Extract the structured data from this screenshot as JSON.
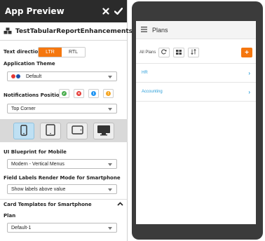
{
  "app_preview": {
    "title": "App Preview",
    "close_icon": "close-icon",
    "confirm_icon": "check-icon"
  },
  "app_name": "TestTabularReportEnhancements",
  "text_direction": {
    "label": "Text direction",
    "options": [
      "LTR",
      "RTL"
    ],
    "selected": "LTR"
  },
  "application_theme": {
    "label": "Application Theme",
    "value": "Default",
    "swatch_colors": [
      "#e53935",
      "#1e4fa8"
    ]
  },
  "notifications_position": {
    "label": "Notifications Position",
    "icons": [
      "success-icon",
      "error-icon",
      "info-icon",
      "warning-icon"
    ],
    "colors": [
      "#4caf50",
      "#e53935",
      "#2196f3",
      "#f5a623"
    ],
    "value": "Top Corner"
  },
  "devices": [
    "smartphone",
    "tablet-portrait",
    "tablet-landscape",
    "desktop"
  ],
  "ui_blueprint": {
    "label": "UI Blueprint for Mobile",
    "value": "Modern - Vertical Menus"
  },
  "field_labels": {
    "label": "Field Labels Render Mode for Smartphone",
    "value": "Show labels above value"
  },
  "card_templates": {
    "label": "Card Templates for Smartphone"
  },
  "plan": {
    "label": "Plan",
    "value": "Default-1"
  },
  "phone": {
    "title": "Plans",
    "all_plans": "All Plans",
    "items": [
      "HR",
      "Accounting"
    ],
    "accent": "#f5770f",
    "link_color": "#2b9ed9"
  }
}
